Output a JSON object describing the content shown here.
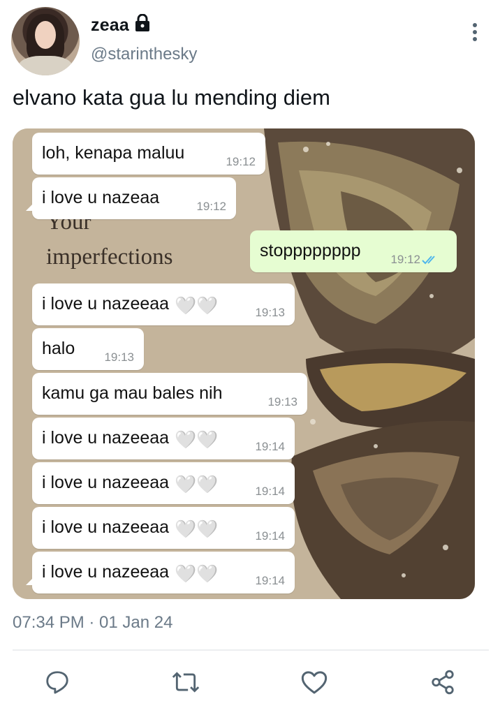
{
  "author": {
    "display_name": "zeaa",
    "handle": "@starinthesky",
    "protected_icon": "lock-icon"
  },
  "tweet": {
    "text": "elvano kata gua lu mending diem",
    "timestamp": "07:34 PM · 01 Jan 24"
  },
  "chat": {
    "wallpaper_text": [
      "Your",
      "imperfections"
    ],
    "messages": [
      {
        "text": "loh, kenapa maluu",
        "time": "19:12",
        "direction": "in"
      },
      {
        "text": "i love u nazeaa",
        "time": "19:12",
        "direction": "in"
      },
      {
        "text": "stopppppppp",
        "time": "19:12",
        "direction": "out",
        "status": "read"
      },
      {
        "text": "i love u nazeeaa",
        "time": "19:13",
        "direction": "in",
        "emoji": "🤍🤍"
      },
      {
        "text": "halo",
        "time": "19:13",
        "direction": "in"
      },
      {
        "text": "kamu ga mau bales nih",
        "time": "19:13",
        "direction": "in"
      },
      {
        "text": "i love u nazeeaa",
        "time": "19:14",
        "direction": "in",
        "emoji": "🤍🤍"
      },
      {
        "text": "i love u nazeeaa",
        "time": "19:14",
        "direction": "in",
        "emoji": "🤍🤍"
      },
      {
        "text": "i love u nazeeaa",
        "time": "19:14",
        "direction": "in",
        "emoji": "🤍🤍"
      },
      {
        "text": "i love u nazeeaa",
        "time": "19:14",
        "direction": "in",
        "emoji": "🤍🤍"
      }
    ]
  },
  "actions": [
    {
      "name": "reply",
      "icon": "reply-icon"
    },
    {
      "name": "retweet",
      "icon": "retweet-icon"
    },
    {
      "name": "like",
      "icon": "heart-icon"
    },
    {
      "name": "share",
      "icon": "share-icon"
    }
  ],
  "colors": {
    "secondary_text": "#6b7a88",
    "outgoing_bubble": "#e6fdd2",
    "read_tick": "#4fb6ec"
  }
}
